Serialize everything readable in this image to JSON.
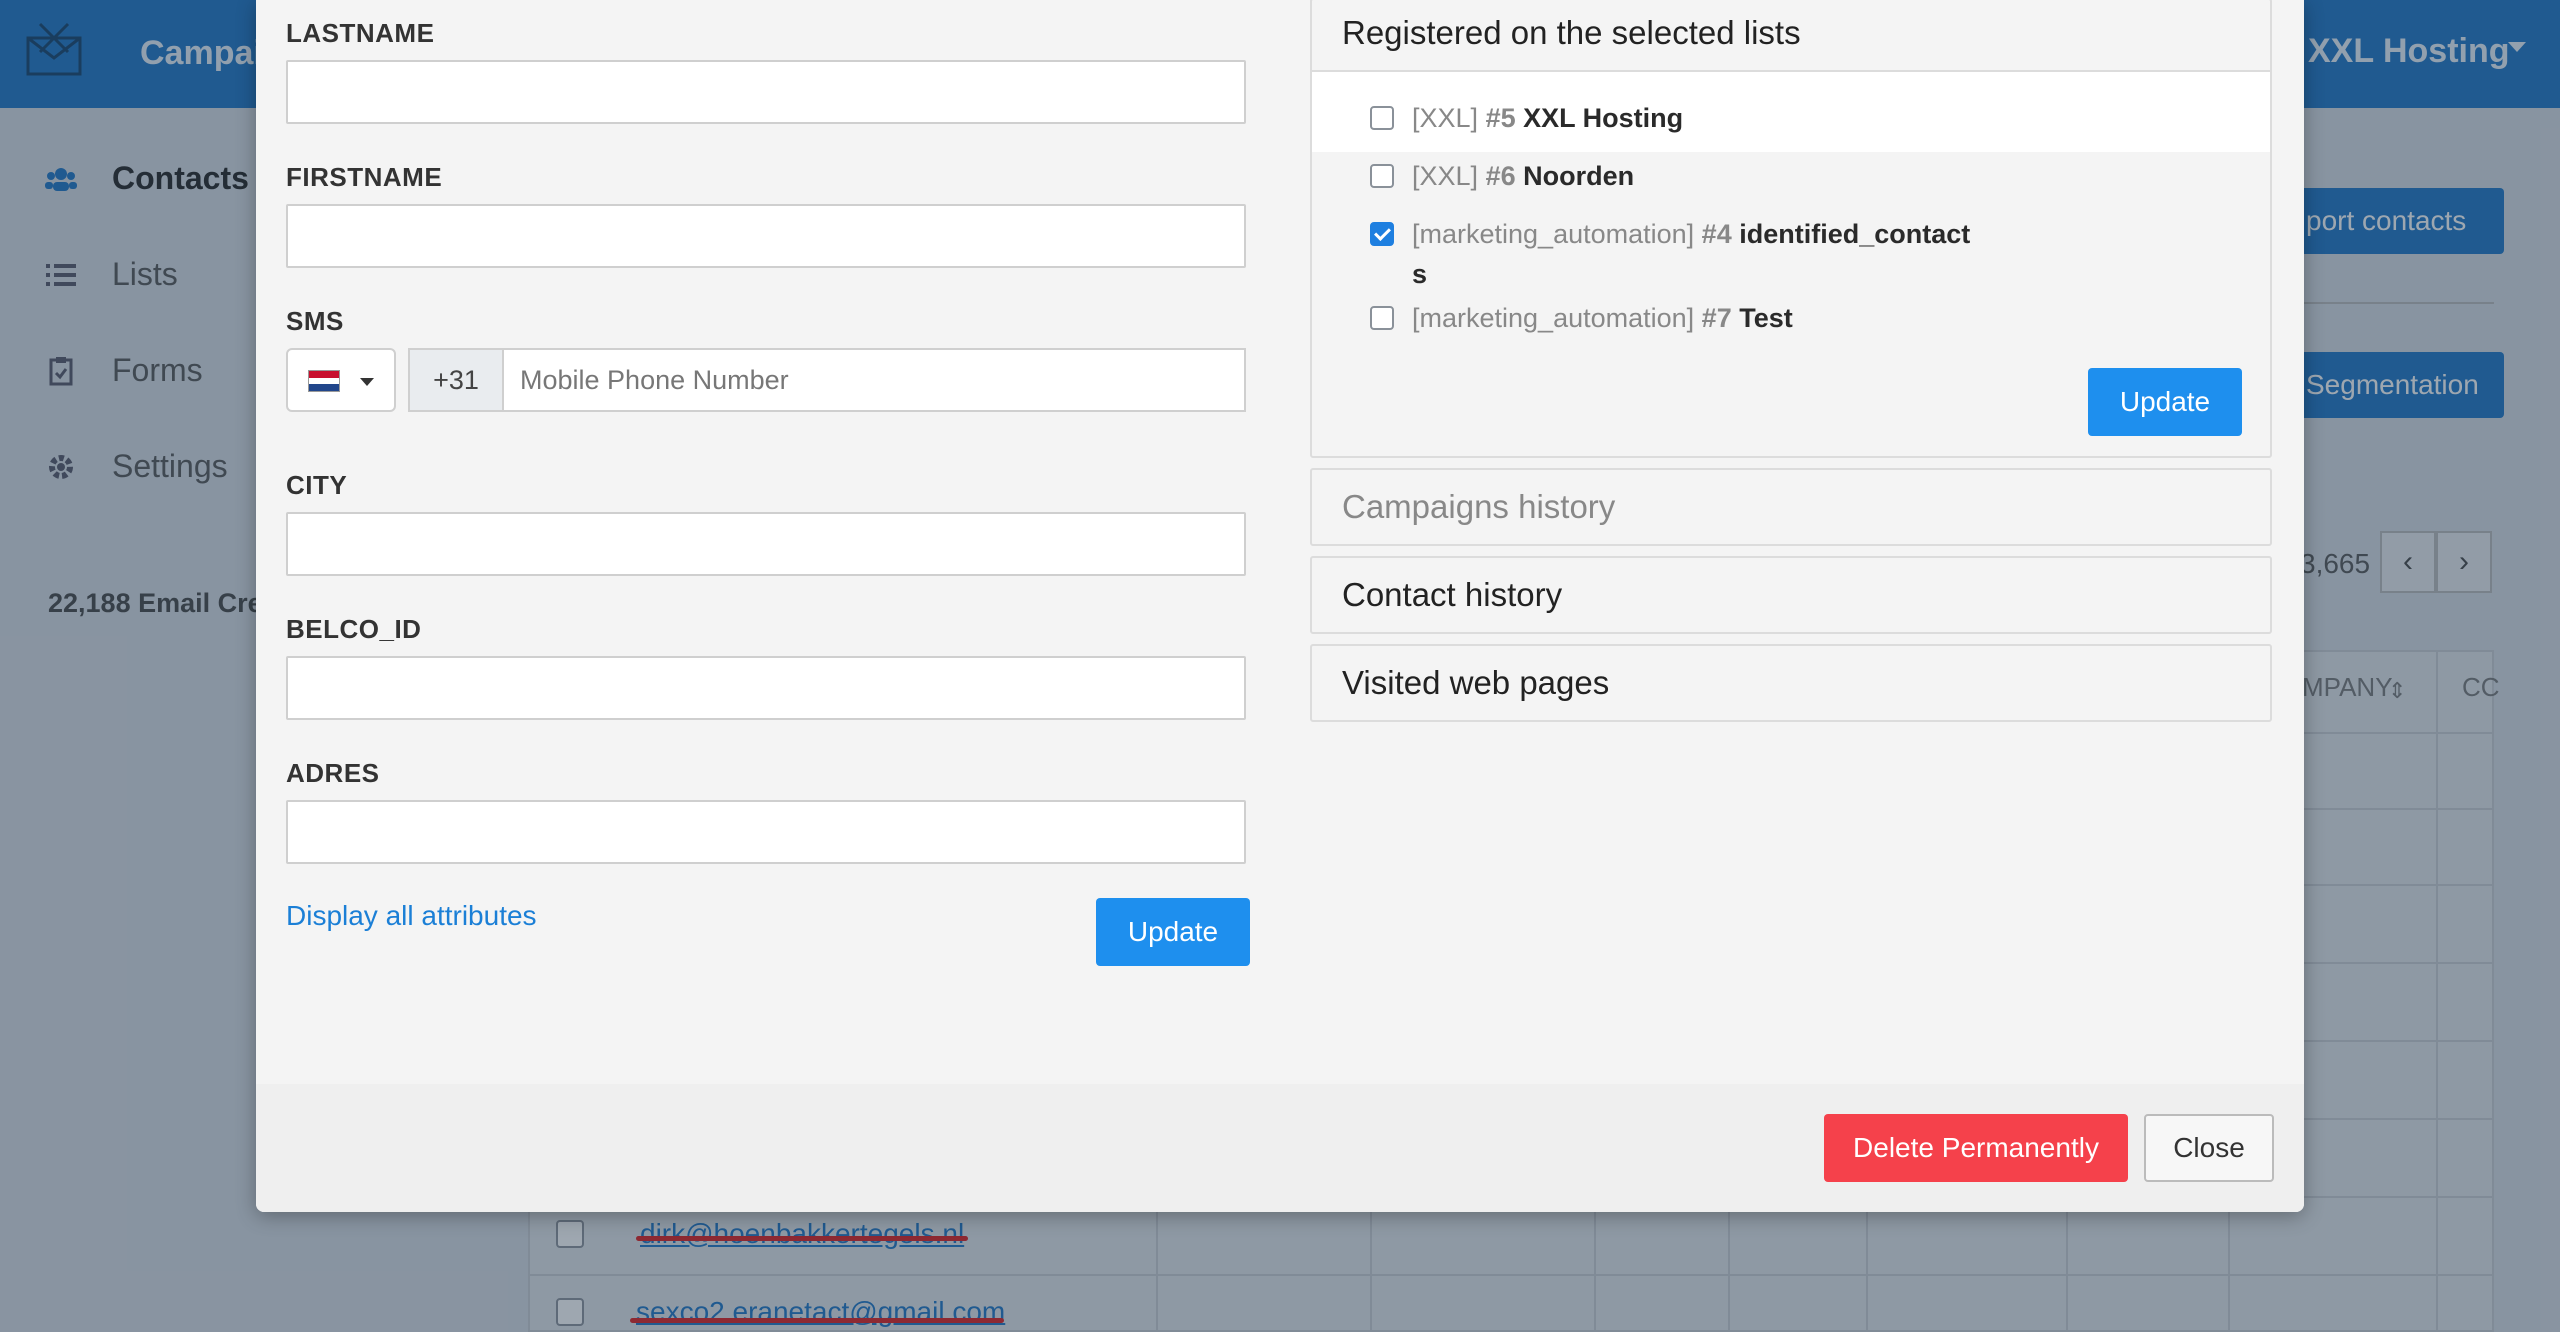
{
  "background": {
    "brand": "Campai",
    "account": "XXL Hosting",
    "sidebar": [
      {
        "label": "Contacts",
        "icon": "users-icon"
      },
      {
        "label": "Lists",
        "icon": "list-icon"
      },
      {
        "label": "Forms",
        "icon": "clipboard-icon"
      },
      {
        "label": "Settings",
        "icon": "gear-icon"
      }
    ],
    "credits": "22,188 Email Cre",
    "import_button": "port contacts",
    "segmentation_button": "Segmentation",
    "pager_count": "3,665",
    "table_headers": [
      "MPANY",
      "CC"
    ],
    "rows": [
      {
        "email": "dirk@hoenbakkertegels.nl"
      },
      {
        "email": "sexco2.eranetact@gmail.com"
      }
    ]
  },
  "form": {
    "lastname_label": "LASTNAME",
    "firstname_label": "FIRSTNAME",
    "sms_label": "SMS",
    "phone_prefix": "+31",
    "phone_placeholder": "Mobile Phone Number",
    "city_label": "CITY",
    "belco_label": "BELCO_ID",
    "adres_label": "ADRES",
    "display_all_link": "Display all attributes",
    "update_label": "Update"
  },
  "lists_panel": {
    "title": "Registered on the selected lists",
    "items": [
      {
        "folder": "[XXL]",
        "id": "#5",
        "name": "XXL Hosting",
        "checked": false
      },
      {
        "folder": "[XXL]",
        "id": "#6",
        "name": "Noorden",
        "checked": false
      },
      {
        "folder": "[marketing_automation]",
        "id": "#4",
        "name": "identified_contacts",
        "checked": true
      },
      {
        "folder": "[marketing_automation]",
        "id": "#7",
        "name": "Test",
        "checked": false
      }
    ],
    "update_label": "Update"
  },
  "accordions": {
    "campaigns_history": "Campaigns history",
    "contact_history": "Contact history",
    "visited_web_pages": "Visited web pages"
  },
  "footer": {
    "delete_label": "Delete Permanently",
    "close_label": "Close"
  },
  "colors": {
    "primary": "#1e8fee",
    "danger": "#f5414b",
    "topbar": "#1b74c5"
  }
}
